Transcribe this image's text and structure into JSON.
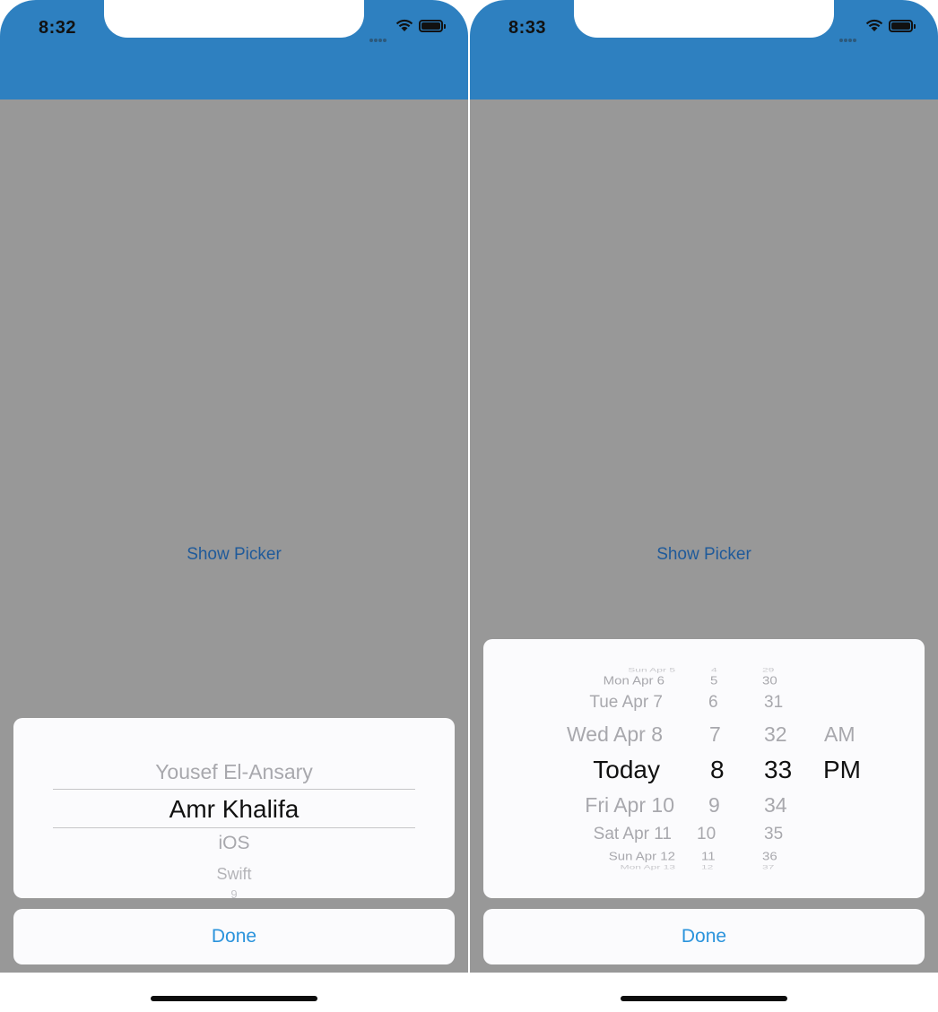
{
  "left_screen": {
    "status_time": "8:32",
    "show_picker_label": "Show Picker",
    "picker_items": {
      "above": "Yousef El-Ansary",
      "selected": "Amr Khalifa",
      "below1": "iOS",
      "below2": "Swift",
      "below3": "9"
    },
    "done_label": "Done"
  },
  "right_screen": {
    "status_time": "8:33",
    "show_picker_label": "Show Picker",
    "date_column": {
      "top_clip": "Sun Apr 5",
      "rows": [
        "Mon Apr 6",
        "Tue Apr 7",
        "Wed Apr 8",
        "Today",
        "Fri Apr 10",
        "Sat Apr 11",
        "Sun Apr 12"
      ],
      "bottom_clip": "Mon Apr 13"
    },
    "hour_column": {
      "top_clip": "4",
      "rows": [
        "5",
        "6",
        "7",
        "8",
        "9",
        "10",
        "11"
      ],
      "bottom_clip": "12"
    },
    "minute_column": {
      "top_clip": "29",
      "rows": [
        "30",
        "31",
        "32",
        "33",
        "34",
        "35",
        "36"
      ],
      "bottom_clip": "37"
    },
    "ampm_column": {
      "rows": [
        "AM",
        "PM"
      ]
    },
    "done_label": "Done"
  },
  "colors": {
    "header_blue": "#2e80c0",
    "overlay_gray": "#989898",
    "link_blue": "#1f5a9a",
    "done_blue": "#2a93dc"
  },
  "icons": [
    "cellular-signal-icon",
    "wifi-icon",
    "battery-icon"
  ]
}
